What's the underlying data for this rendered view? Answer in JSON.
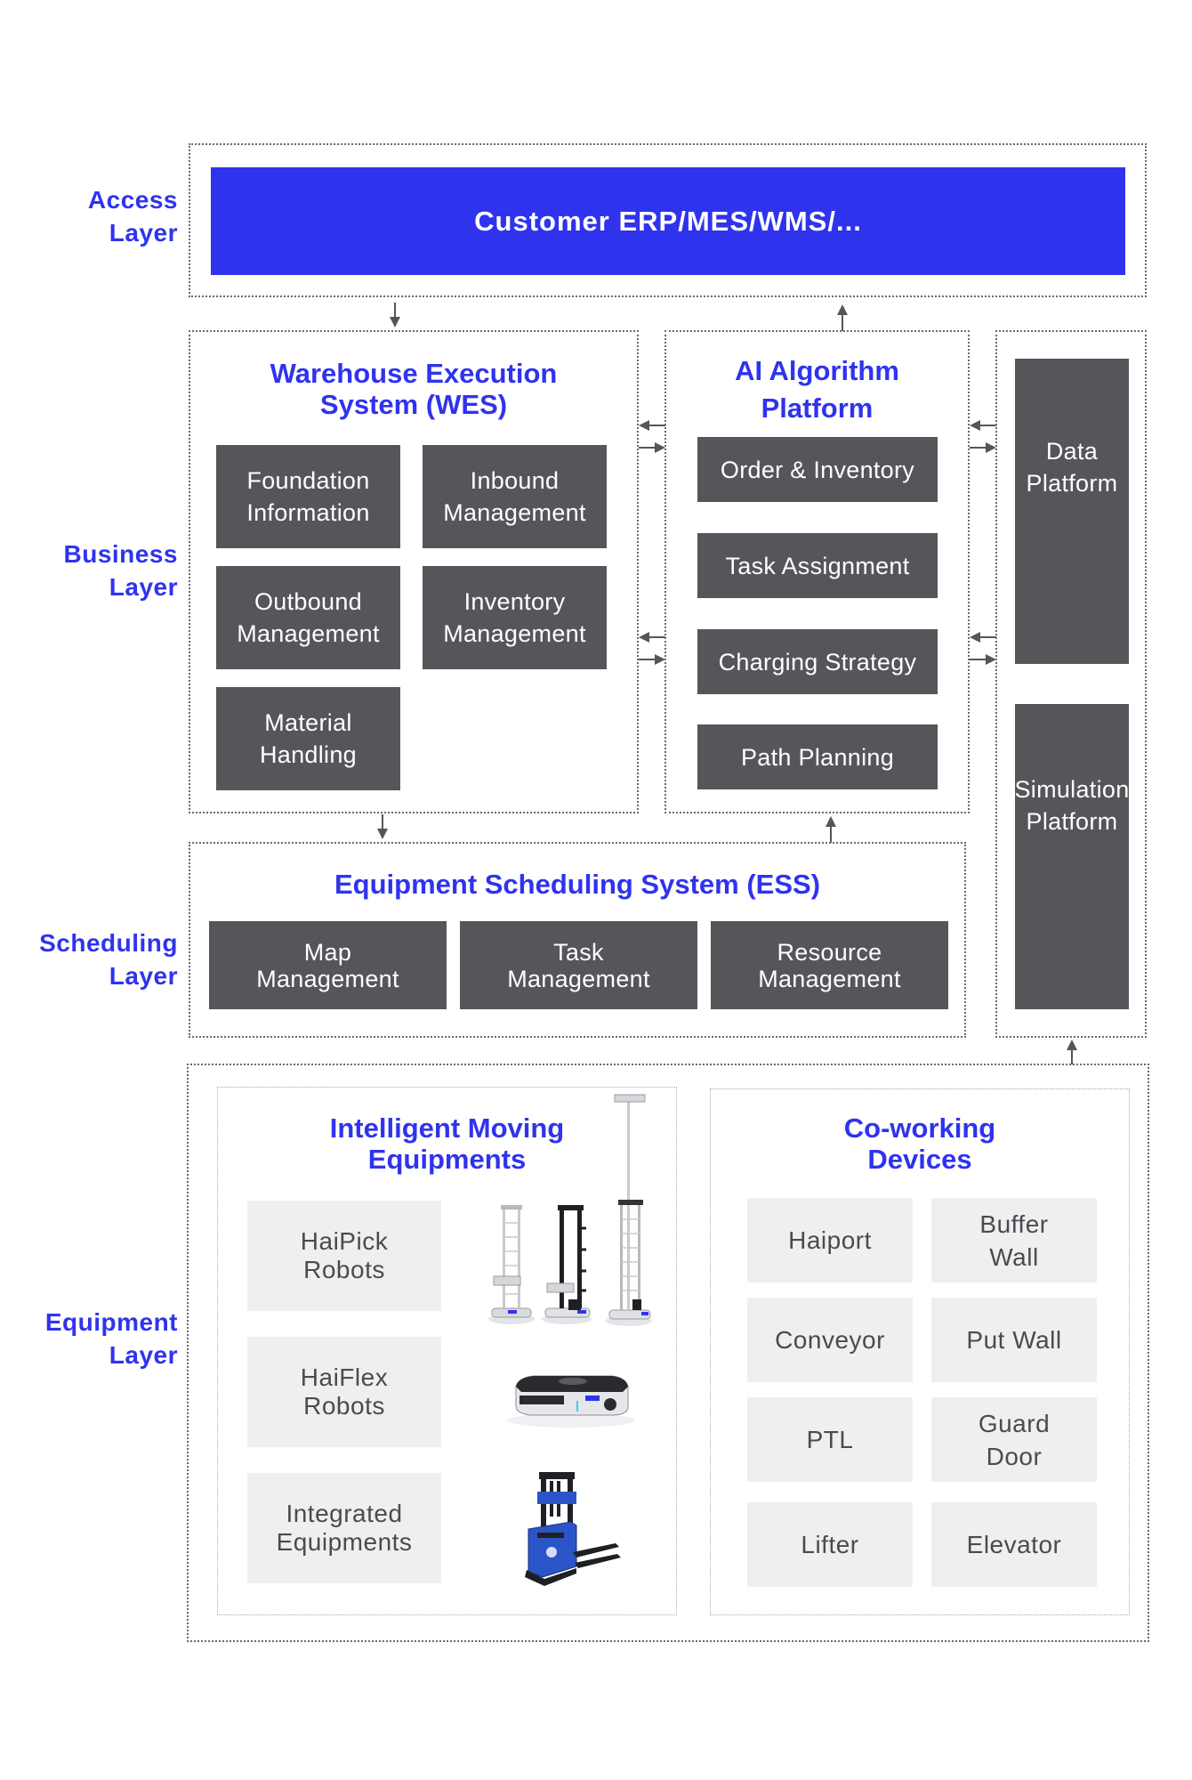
{
  "colors": {
    "accent_blue": "#2f33ee",
    "dark_box": "#55565a",
    "light_box": "#efefef",
    "light_box_text": "#4a4b50",
    "border": "#6a6b70"
  },
  "layers": {
    "access": "Access\nLayer",
    "business": "Business\nLayer",
    "scheduling": "Scheduling\nLayer",
    "equipment": "Equipment\nLayer"
  },
  "access": {
    "customer_systems": "Customer ERP/MES/WMS/..."
  },
  "wes": {
    "title": "Warehouse Execution\nSystem (WES)",
    "modules": [
      "Foundation\nInformation",
      "Inbound\nManagement",
      "Outbound\nManagement",
      "Inventory\nManagement",
      "Material\nHandling"
    ]
  },
  "ai": {
    "title": "AI Algorithm\nPlatform",
    "modules": [
      "Order & Inventory",
      "Task Assignment",
      "Charging Strategy",
      "Path Planning"
    ]
  },
  "platforms": {
    "data": "Data\nPlatform",
    "simulation": "Simulation\nPlatform"
  },
  "ess": {
    "title": "Equipment Scheduling System (ESS)",
    "modules": [
      "Map\nManagement",
      "Task\nManagement",
      "Resource\nManagement"
    ]
  },
  "equipment": {
    "moving": {
      "title": "Intelligent Moving\nEquipments",
      "items": [
        {
          "label": "HaiPick\nRobots",
          "image": "haipick-robots-icon"
        },
        {
          "label": "HaiFlex\nRobots",
          "image": "haiflex-robot-icon"
        },
        {
          "label": "Integrated\nEquipments",
          "image": "forklift-robot-icon"
        }
      ]
    },
    "coworking": {
      "title": "Co-working\nDevices",
      "items": [
        "Haiport",
        "Buffer\nWall",
        "Conveyor",
        "Put Wall",
        "PTL",
        "Guard\nDoor",
        "Lifter",
        "Elevator"
      ]
    }
  }
}
